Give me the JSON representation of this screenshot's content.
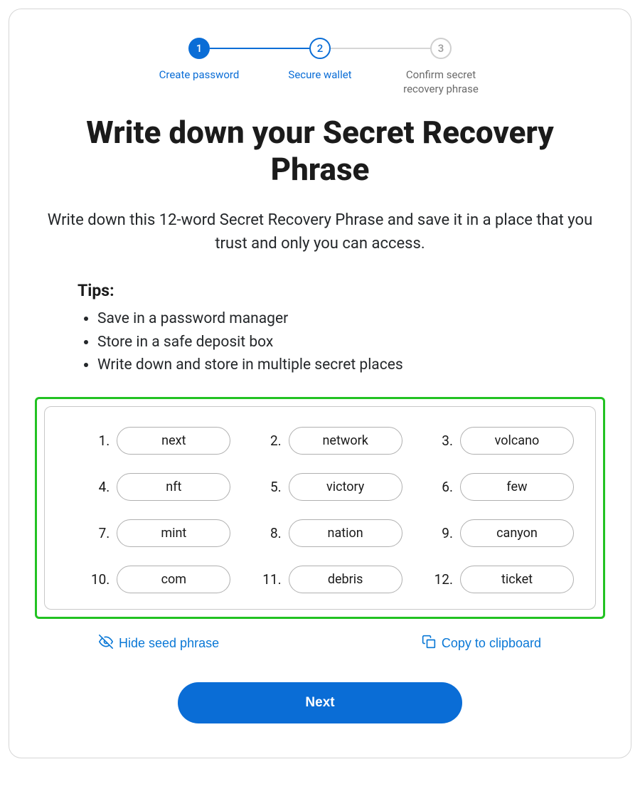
{
  "stepper": {
    "step1": {
      "num": "1",
      "label": "Create password"
    },
    "step2": {
      "num": "2",
      "label": "Secure wallet"
    },
    "step3": {
      "num": "3",
      "label": "Confirm secret recovery phrase"
    }
  },
  "title": "Write down your Secret Recovery Phrase",
  "subtitle": "Write down this 12-word Secret Recovery Phrase and save it in a place that you trust and only you can access.",
  "tips": {
    "heading": "Tips:",
    "items": [
      "Save in a password manager",
      "Store in a safe deposit box",
      "Write down and store in multiple secret places"
    ]
  },
  "phrase": {
    "words": [
      {
        "n": "1.",
        "w": "next"
      },
      {
        "n": "2.",
        "w": "network"
      },
      {
        "n": "3.",
        "w": "volcano"
      },
      {
        "n": "4.",
        "w": "nft"
      },
      {
        "n": "5.",
        "w": "victory"
      },
      {
        "n": "6.",
        "w": "few"
      },
      {
        "n": "7.",
        "w": "mint"
      },
      {
        "n": "8.",
        "w": "nation"
      },
      {
        "n": "9.",
        "w": "canyon"
      },
      {
        "n": "10.",
        "w": "com"
      },
      {
        "n": "11.",
        "w": "debris"
      },
      {
        "n": "12.",
        "w": "ticket"
      }
    ]
  },
  "actions": {
    "hide": "Hide seed phrase",
    "copy": "Copy to clipboard"
  },
  "next_button": "Next"
}
